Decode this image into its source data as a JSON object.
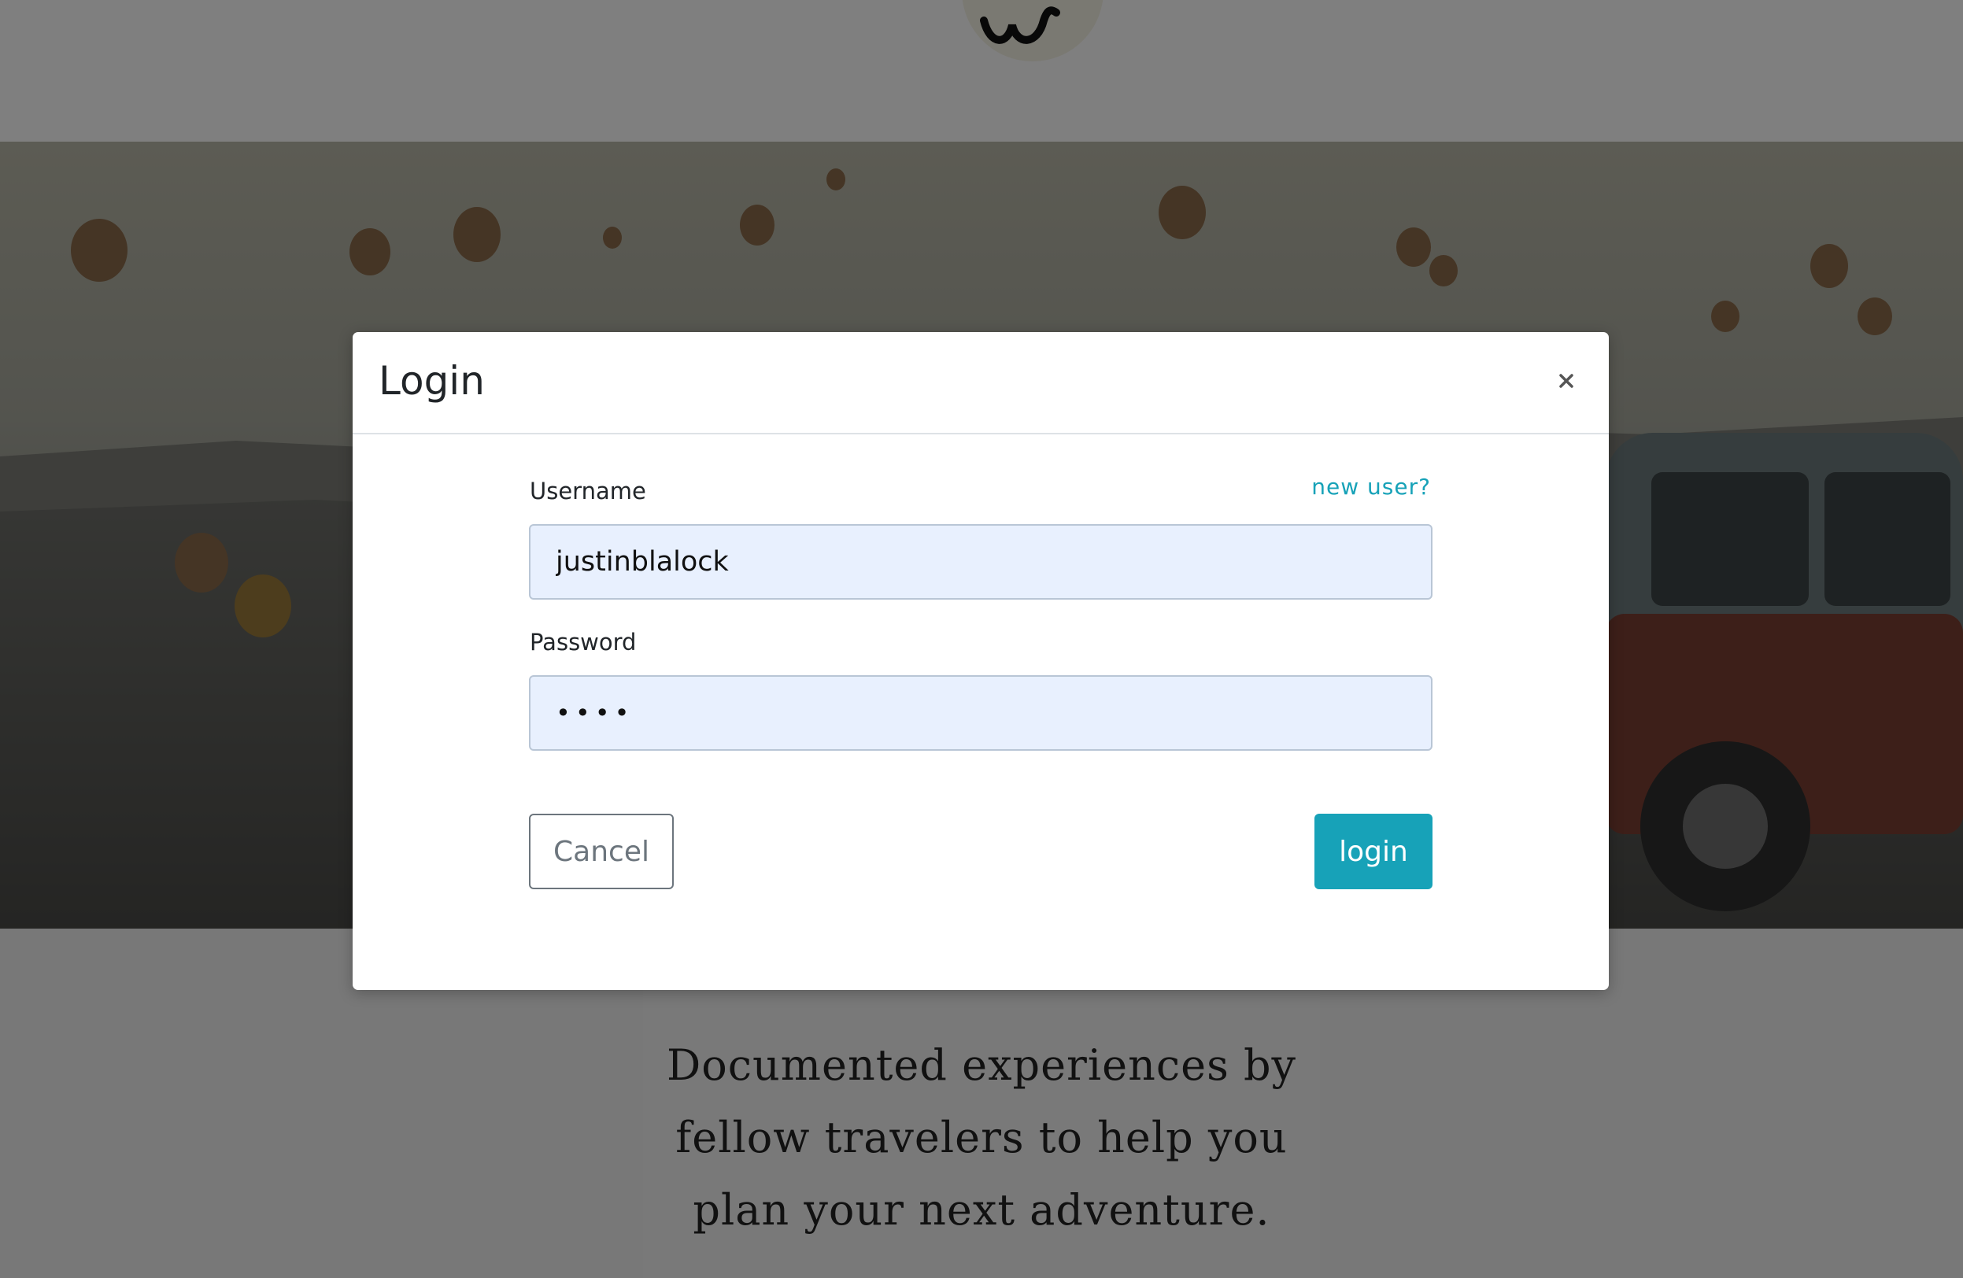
{
  "page": {
    "tagline": "Documented experiences by fellow travelers to help you plan your next adventure."
  },
  "modal": {
    "title": "Login",
    "close_icon": "close-icon",
    "username_label": "Username",
    "new_user_link": "new user?",
    "username_value": "justinblalock",
    "password_label": "Password",
    "password_value": "test",
    "cancel_label": "Cancel",
    "login_label": "login"
  },
  "colors": {
    "accent": "#17a2b8",
    "input_autofill_bg": "#e8f0fe",
    "backdrop": "rgba(0,0,0,0.5)"
  }
}
